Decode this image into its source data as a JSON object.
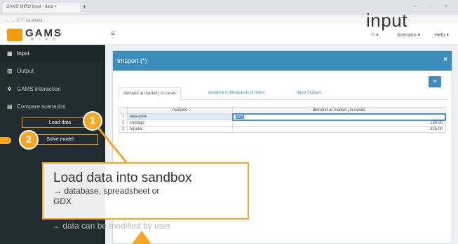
{
  "browser": {
    "tab_title": "GAMS MIRO input - data ×",
    "new_tab": "+",
    "url": "← → C ⓘ localhost"
  },
  "brand": {
    "logo_text": "GAMS",
    "logo_sub": "M I R O"
  },
  "sidebar": {
    "items": [
      {
        "label": "Input",
        "icon": "table-icon",
        "glyph": "▦"
      },
      {
        "label": "Output",
        "icon": "chart-icon",
        "glyph": "▥"
      },
      {
        "label": "GAMS interaction",
        "icon": "gear-icon",
        "glyph": "✲"
      },
      {
        "label": "Compare scenarios",
        "icon": "compare-icon",
        "glyph": "▤"
      }
    ],
    "load_button": "Load data",
    "solve_button": "Solve model"
  },
  "topbar": {
    "menu_icon": "≡",
    "user": "⚇ ▾",
    "scenario_menu": "Scenario ▾",
    "help_menu": "Help ▾"
  },
  "panel": {
    "title": "trnsport (*)",
    "close": "×",
    "tool_icon": "≣",
    "tabs": [
      "demand at market j in cases",
      "distance in thousands of miles",
      "Input Scalars"
    ],
    "table": {
      "columns": [
        "markets",
        "demand at market j in cases"
      ],
      "rows": [
        {
          "idx": "1",
          "market": "new-york",
          "value": "325"
        },
        {
          "idx": "2",
          "market": "chicago",
          "value": "180.00"
        },
        {
          "idx": "3",
          "market": "topeka",
          "value": "325.00"
        }
      ]
    }
  },
  "annotation": {
    "label": "input",
    "badge_1": "1",
    "badge_2": "2",
    "callout_title": "Load data into sandbox",
    "callout_line_1": "→ database, spreadsheet or",
    "callout_line_2": "GDX",
    "callout_line_3": "→ data can be modified by user",
    "accent_color": "#f5a623"
  }
}
